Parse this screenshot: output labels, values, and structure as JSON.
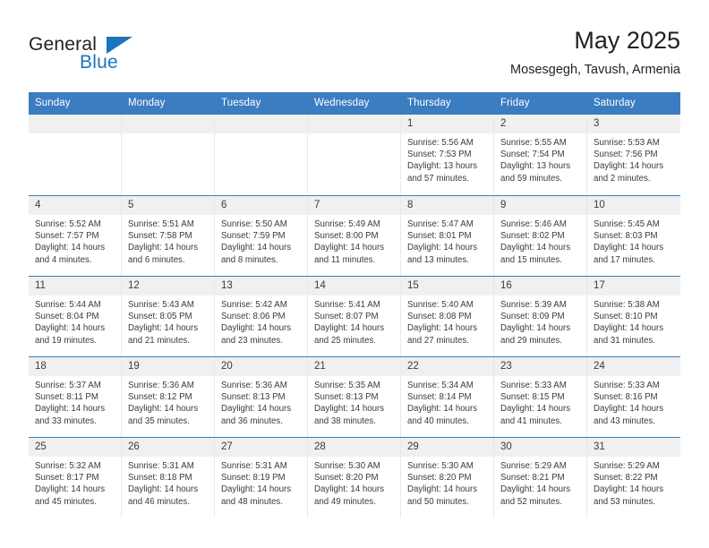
{
  "brand": {
    "name_part1": "General",
    "name_part2": "Blue",
    "accent_color": "#1b75bc",
    "logo_icon": "triangle-icon"
  },
  "header": {
    "title": "May 2025",
    "subtitle": "Mosesgegh, Tavush, Armenia"
  },
  "calendar": {
    "header_color": "#3b7dc0",
    "weekdays": [
      "Sunday",
      "Monday",
      "Tuesday",
      "Wednesday",
      "Thursday",
      "Friday",
      "Saturday"
    ],
    "weeks": [
      [
        {
          "day": "",
          "empty": true,
          "sunrise": "",
          "sunset": "",
          "daylight1": "",
          "daylight2": ""
        },
        {
          "day": "",
          "empty": true,
          "sunrise": "",
          "sunset": "",
          "daylight1": "",
          "daylight2": ""
        },
        {
          "day": "",
          "empty": true,
          "sunrise": "",
          "sunset": "",
          "daylight1": "",
          "daylight2": ""
        },
        {
          "day": "",
          "empty": true,
          "sunrise": "",
          "sunset": "",
          "daylight1": "",
          "daylight2": ""
        },
        {
          "day": "1",
          "empty": false,
          "sunrise": "Sunrise: 5:56 AM",
          "sunset": "Sunset: 7:53 PM",
          "daylight1": "Daylight: 13 hours",
          "daylight2": "and 57 minutes."
        },
        {
          "day": "2",
          "empty": false,
          "sunrise": "Sunrise: 5:55 AM",
          "sunset": "Sunset: 7:54 PM",
          "daylight1": "Daylight: 13 hours",
          "daylight2": "and 59 minutes."
        },
        {
          "day": "3",
          "empty": false,
          "sunrise": "Sunrise: 5:53 AM",
          "sunset": "Sunset: 7:56 PM",
          "daylight1": "Daylight: 14 hours",
          "daylight2": "and 2 minutes."
        }
      ],
      [
        {
          "day": "4",
          "empty": false,
          "sunrise": "Sunrise: 5:52 AM",
          "sunset": "Sunset: 7:57 PM",
          "daylight1": "Daylight: 14 hours",
          "daylight2": "and 4 minutes."
        },
        {
          "day": "5",
          "empty": false,
          "sunrise": "Sunrise: 5:51 AM",
          "sunset": "Sunset: 7:58 PM",
          "daylight1": "Daylight: 14 hours",
          "daylight2": "and 6 minutes."
        },
        {
          "day": "6",
          "empty": false,
          "sunrise": "Sunrise: 5:50 AM",
          "sunset": "Sunset: 7:59 PM",
          "daylight1": "Daylight: 14 hours",
          "daylight2": "and 8 minutes."
        },
        {
          "day": "7",
          "empty": false,
          "sunrise": "Sunrise: 5:49 AM",
          "sunset": "Sunset: 8:00 PM",
          "daylight1": "Daylight: 14 hours",
          "daylight2": "and 11 minutes."
        },
        {
          "day": "8",
          "empty": false,
          "sunrise": "Sunrise: 5:47 AM",
          "sunset": "Sunset: 8:01 PM",
          "daylight1": "Daylight: 14 hours",
          "daylight2": "and 13 minutes."
        },
        {
          "day": "9",
          "empty": false,
          "sunrise": "Sunrise: 5:46 AM",
          "sunset": "Sunset: 8:02 PM",
          "daylight1": "Daylight: 14 hours",
          "daylight2": "and 15 minutes."
        },
        {
          "day": "10",
          "empty": false,
          "sunrise": "Sunrise: 5:45 AM",
          "sunset": "Sunset: 8:03 PM",
          "daylight1": "Daylight: 14 hours",
          "daylight2": "and 17 minutes."
        }
      ],
      [
        {
          "day": "11",
          "empty": false,
          "sunrise": "Sunrise: 5:44 AM",
          "sunset": "Sunset: 8:04 PM",
          "daylight1": "Daylight: 14 hours",
          "daylight2": "and 19 minutes."
        },
        {
          "day": "12",
          "empty": false,
          "sunrise": "Sunrise: 5:43 AM",
          "sunset": "Sunset: 8:05 PM",
          "daylight1": "Daylight: 14 hours",
          "daylight2": "and 21 minutes."
        },
        {
          "day": "13",
          "empty": false,
          "sunrise": "Sunrise: 5:42 AM",
          "sunset": "Sunset: 8:06 PM",
          "daylight1": "Daylight: 14 hours",
          "daylight2": "and 23 minutes."
        },
        {
          "day": "14",
          "empty": false,
          "sunrise": "Sunrise: 5:41 AM",
          "sunset": "Sunset: 8:07 PM",
          "daylight1": "Daylight: 14 hours",
          "daylight2": "and 25 minutes."
        },
        {
          "day": "15",
          "empty": false,
          "sunrise": "Sunrise: 5:40 AM",
          "sunset": "Sunset: 8:08 PM",
          "daylight1": "Daylight: 14 hours",
          "daylight2": "and 27 minutes."
        },
        {
          "day": "16",
          "empty": false,
          "sunrise": "Sunrise: 5:39 AM",
          "sunset": "Sunset: 8:09 PM",
          "daylight1": "Daylight: 14 hours",
          "daylight2": "and 29 minutes."
        },
        {
          "day": "17",
          "empty": false,
          "sunrise": "Sunrise: 5:38 AM",
          "sunset": "Sunset: 8:10 PM",
          "daylight1": "Daylight: 14 hours",
          "daylight2": "and 31 minutes."
        }
      ],
      [
        {
          "day": "18",
          "empty": false,
          "sunrise": "Sunrise: 5:37 AM",
          "sunset": "Sunset: 8:11 PM",
          "daylight1": "Daylight: 14 hours",
          "daylight2": "and 33 minutes."
        },
        {
          "day": "19",
          "empty": false,
          "sunrise": "Sunrise: 5:36 AM",
          "sunset": "Sunset: 8:12 PM",
          "daylight1": "Daylight: 14 hours",
          "daylight2": "and 35 minutes."
        },
        {
          "day": "20",
          "empty": false,
          "sunrise": "Sunrise: 5:36 AM",
          "sunset": "Sunset: 8:13 PM",
          "daylight1": "Daylight: 14 hours",
          "daylight2": "and 36 minutes."
        },
        {
          "day": "21",
          "empty": false,
          "sunrise": "Sunrise: 5:35 AM",
          "sunset": "Sunset: 8:13 PM",
          "daylight1": "Daylight: 14 hours",
          "daylight2": "and 38 minutes."
        },
        {
          "day": "22",
          "empty": false,
          "sunrise": "Sunrise: 5:34 AM",
          "sunset": "Sunset: 8:14 PM",
          "daylight1": "Daylight: 14 hours",
          "daylight2": "and 40 minutes."
        },
        {
          "day": "23",
          "empty": false,
          "sunrise": "Sunrise: 5:33 AM",
          "sunset": "Sunset: 8:15 PM",
          "daylight1": "Daylight: 14 hours",
          "daylight2": "and 41 minutes."
        },
        {
          "day": "24",
          "empty": false,
          "sunrise": "Sunrise: 5:33 AM",
          "sunset": "Sunset: 8:16 PM",
          "daylight1": "Daylight: 14 hours",
          "daylight2": "and 43 minutes."
        }
      ],
      [
        {
          "day": "25",
          "empty": false,
          "sunrise": "Sunrise: 5:32 AM",
          "sunset": "Sunset: 8:17 PM",
          "daylight1": "Daylight: 14 hours",
          "daylight2": "and 45 minutes."
        },
        {
          "day": "26",
          "empty": false,
          "sunrise": "Sunrise: 5:31 AM",
          "sunset": "Sunset: 8:18 PM",
          "daylight1": "Daylight: 14 hours",
          "daylight2": "and 46 minutes."
        },
        {
          "day": "27",
          "empty": false,
          "sunrise": "Sunrise: 5:31 AM",
          "sunset": "Sunset: 8:19 PM",
          "daylight1": "Daylight: 14 hours",
          "daylight2": "and 48 minutes."
        },
        {
          "day": "28",
          "empty": false,
          "sunrise": "Sunrise: 5:30 AM",
          "sunset": "Sunset: 8:20 PM",
          "daylight1": "Daylight: 14 hours",
          "daylight2": "and 49 minutes."
        },
        {
          "day": "29",
          "empty": false,
          "sunrise": "Sunrise: 5:30 AM",
          "sunset": "Sunset: 8:20 PM",
          "daylight1": "Daylight: 14 hours",
          "daylight2": "and 50 minutes."
        },
        {
          "day": "30",
          "empty": false,
          "sunrise": "Sunrise: 5:29 AM",
          "sunset": "Sunset: 8:21 PM",
          "daylight1": "Daylight: 14 hours",
          "daylight2": "and 52 minutes."
        },
        {
          "day": "31",
          "empty": false,
          "sunrise": "Sunrise: 5:29 AM",
          "sunset": "Sunset: 8:22 PM",
          "daylight1": "Daylight: 14 hours",
          "daylight2": "and 53 minutes."
        }
      ]
    ]
  }
}
